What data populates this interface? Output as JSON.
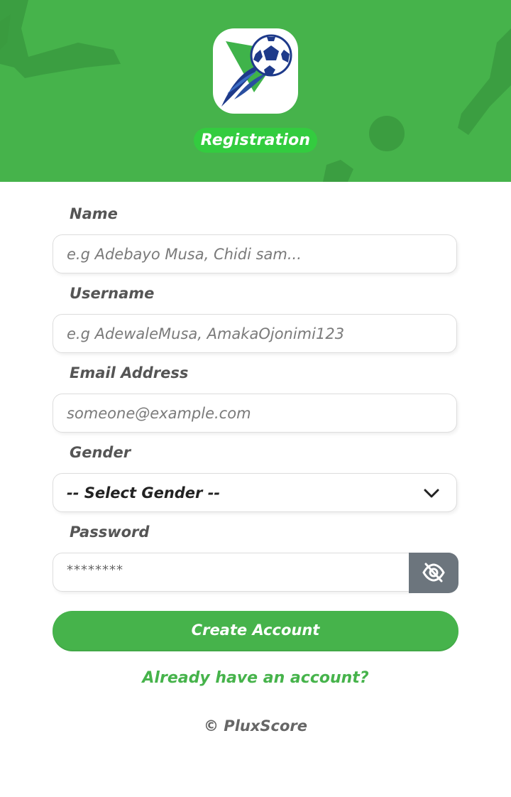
{
  "header": {
    "badge_label": "Registration",
    "background_color": "#46b34b",
    "badge_color": "#33cc3f",
    "logo_icon": "soccer-ball-icon"
  },
  "form": {
    "name": {
      "label": "Name",
      "placeholder": "e.g Adebayo Musa, Chidi sam..."
    },
    "username": {
      "label": "Username",
      "placeholder": "e.g AdewaleMusa, AmakaOjonimi123"
    },
    "email": {
      "label": "Email Address",
      "placeholder": "someone@example.com"
    },
    "gender": {
      "label": "Gender",
      "selected": "-- Select Gender --",
      "icon": "chevron-down-icon"
    },
    "password": {
      "label": "Password",
      "value": "********",
      "toggle_icon": "eye-slash-icon"
    }
  },
  "actions": {
    "create_account_label": "Create Account",
    "login_link_label": "Already have an account?"
  },
  "footer": {
    "copyright": "© PluxScore"
  },
  "colors": {
    "accent": "#46b34b",
    "toggle_button": "#6c757d"
  }
}
